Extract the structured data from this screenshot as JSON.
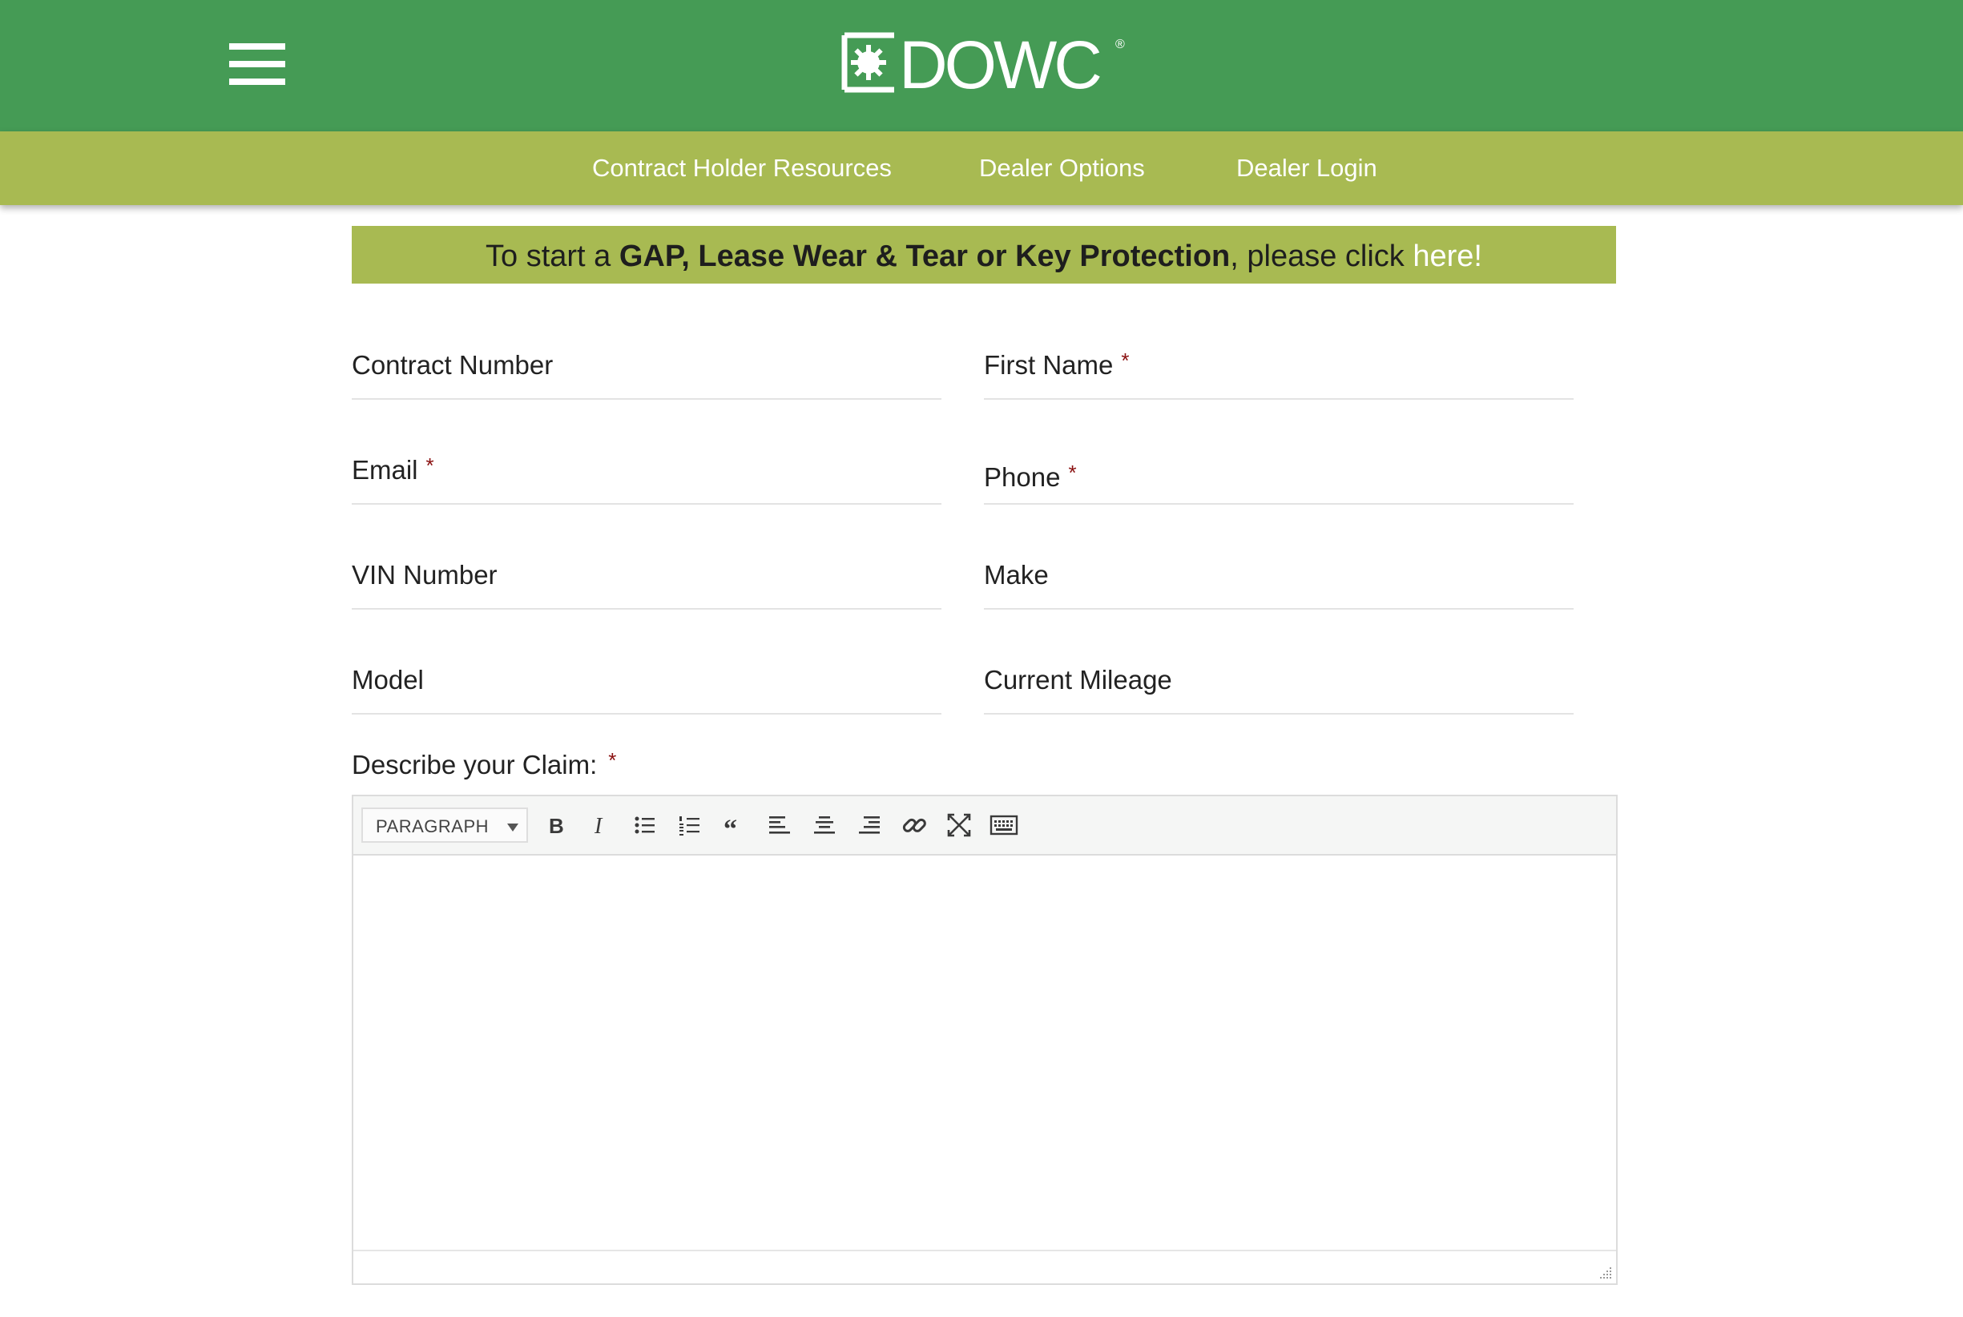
{
  "header": {
    "logo_text": "DOWC",
    "registered": "®",
    "menu_icon": "hamburger-menu-icon",
    "brand_color": "#459b55"
  },
  "subnav": {
    "color": "#a8ba52",
    "items": [
      {
        "label": "Contract Holder Resources"
      },
      {
        "label": "Dealer Options"
      },
      {
        "label": "Dealer Login"
      }
    ]
  },
  "banner": {
    "prefix": "To start a ",
    "bold": "GAP, Lease Wear & Tear or Key Protection",
    "middle": ", please click ",
    "link": "here!"
  },
  "form": {
    "required_mark": "*",
    "fields": [
      {
        "label": "Contract Number",
        "required": false,
        "value": ""
      },
      {
        "label": "First Name",
        "required": true,
        "value": ""
      },
      {
        "label": "Email",
        "required": true,
        "value": ""
      },
      {
        "label": "Phone",
        "required": true,
        "value": ""
      },
      {
        "label": "VIN Number",
        "required": false,
        "value": ""
      },
      {
        "label": "Make",
        "required": false,
        "value": ""
      },
      {
        "label": "Model",
        "required": false,
        "value": ""
      },
      {
        "label": "Current Mileage",
        "required": false,
        "value": ""
      }
    ],
    "claim_label": "Describe your Claim:",
    "claim_required": true
  },
  "editor": {
    "format_select": "PARAGRAPH",
    "tools": [
      "bold-icon",
      "italic-icon",
      "bullet-list-icon",
      "numbered-list-icon",
      "blockquote-icon",
      "align-left-icon",
      "align-center-icon",
      "align-right-icon",
      "link-icon",
      "fullscreen-icon",
      "keyboard-icon"
    ],
    "content": ""
  }
}
